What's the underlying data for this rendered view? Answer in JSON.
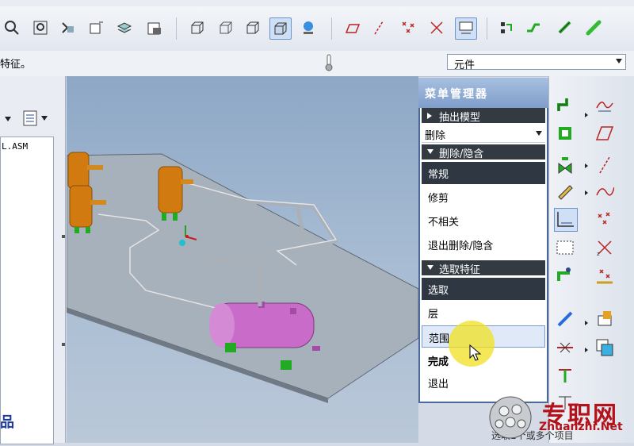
{
  "toolbar": {
    "prompt": "特征。",
    "filter_value": "元件"
  },
  "model_tree": {
    "item": "L.ASM"
  },
  "menu_manager": {
    "title": "菜单管理器",
    "section_extract": "抽出模型",
    "dropdown_value": "删除",
    "section_delete": "删除/隐含",
    "delete_items": [
      "常规",
      "修剪",
      "不相关",
      "退出删除/隐含"
    ],
    "section_select": "选取特征",
    "select_items": [
      "选取",
      "层",
      "范围",
      "完成",
      "退出"
    ]
  },
  "status": {
    "message": "选取1个或多个项目"
  },
  "watermark": {
    "title": "专职网",
    "url": "Zhuanzhi.Net"
  },
  "logo_fragment": "品",
  "colors": {
    "menu_title_bg": "#7e9dc9",
    "menu_section_bg": "#333a42",
    "selected_bg": "#2f3842",
    "vessel": "#d07a10",
    "tank": "#c96cc9",
    "pipe": "#b8bec8",
    "support": "#22aa22",
    "highlight": "#f0e020"
  }
}
